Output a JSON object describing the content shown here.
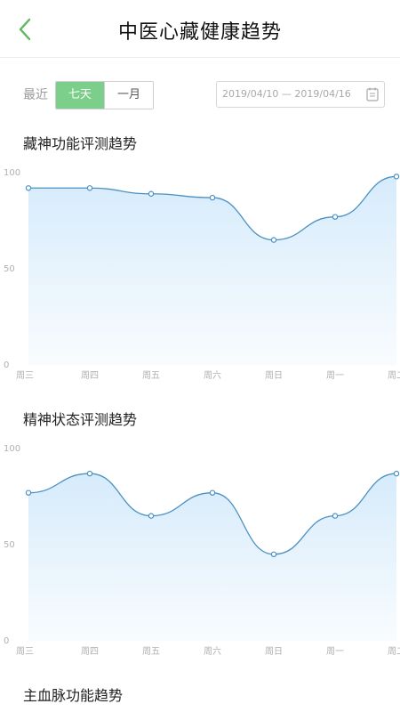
{
  "header": {
    "title": "中医心藏健康趋势",
    "back_icon": "chevron-left-icon",
    "back_color": "#5cb85c"
  },
  "filter": {
    "label": "最近",
    "options": [
      {
        "label": "七天",
        "active": true
      },
      {
        "label": "一月",
        "active": false
      }
    ],
    "active_color": "#7ccf8a",
    "date_range": "2019/04/10 — 2019/04/16",
    "calendar_icon": "calendar-icon"
  },
  "sections": [
    {
      "title": "藏神功能评测趋势"
    },
    {
      "title": "精神状态评测趋势"
    },
    {
      "title": "主血脉功能趋势"
    }
  ],
  "chart_data": [
    {
      "type": "area",
      "categories": [
        "周三",
        "周四",
        "周五",
        "周六",
        "周日",
        "周一",
        "周二"
      ],
      "values": [
        92,
        92,
        89,
        87,
        65,
        77,
        98
      ],
      "ylim": [
        0,
        100
      ],
      "yticks": [
        0,
        50,
        100
      ],
      "grid": false,
      "line_color": "#4a90c2",
      "fill_color": "#d6ebfb"
    },
    {
      "type": "area",
      "categories": [
        "周三",
        "周四",
        "周五",
        "周六",
        "周日",
        "周一",
        "周二"
      ],
      "values": [
        77,
        87,
        65,
        77,
        45,
        65,
        87
      ],
      "ylim": [
        0,
        100
      ],
      "yticks": [
        0,
        50,
        100
      ],
      "grid": false,
      "line_color": "#4a90c2",
      "fill_color": "#d6ebfb"
    }
  ]
}
